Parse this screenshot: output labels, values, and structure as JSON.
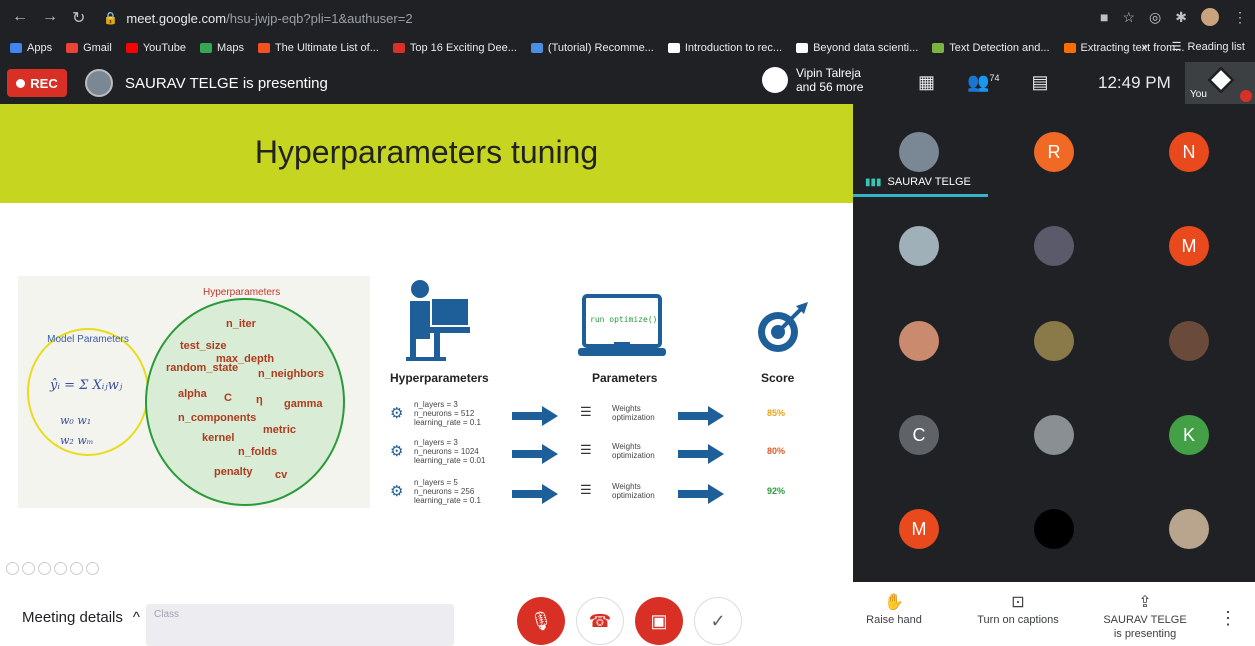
{
  "browser": {
    "url_host": "meet.google.com",
    "url_path": "/hsu-jwjp-eqb?pli=1&authuser=2",
    "bookmarks": [
      {
        "label": "Apps",
        "color": "#4285f4"
      },
      {
        "label": "Gmail",
        "color": "#ea4335"
      },
      {
        "label": "YouTube",
        "color": "#ff0000"
      },
      {
        "label": "Maps",
        "color": "#34a853"
      },
      {
        "label": "The Ultimate List of...",
        "color": "#f4511e"
      },
      {
        "label": "Top 16 Exciting Dee...",
        "color": "#d93025"
      },
      {
        "label": "(Tutorial) Recomme...",
        "color": "#4a90e2"
      },
      {
        "label": "Introduction to rec...",
        "color": "#ffffff"
      },
      {
        "label": "Beyond data scienti...",
        "color": "#ffffff"
      },
      {
        "label": "Text Detection and...",
        "color": "#7cb342"
      },
      {
        "label": "Extracting text from...",
        "color": "#ff6d00"
      }
    ],
    "reading_list": "Reading list",
    "overflow": "»"
  },
  "meet": {
    "rec_label": "REC",
    "presenting_text": "SAURAV TELGE is presenting",
    "vip_name": "Vipin Talreja",
    "vip_more": "and 56 more",
    "people_count": "74",
    "clock": "12:49 PM",
    "you_label": "You"
  },
  "slide": {
    "title": "Hyperparameters tuning",
    "model_params_title": "Model Parameters",
    "formula": "ŷᵢ = Σ Xᵢⱼwⱼ",
    "w_row1": "w₀   w₁",
    "w_row2": "w₂   wₘ",
    "hyper_title": "Hyperparameters",
    "hyperparams": [
      "n_iter",
      "test_size",
      "max_depth",
      "random_state",
      "n_neighbors",
      "alpha",
      "C",
      "η",
      "gamma",
      "n_components",
      "metric",
      "kernel",
      "n_folds",
      "penalty",
      "cv"
    ],
    "col_hyper": "Hyperparameters",
    "col_params": "Parameters",
    "col_score": "Score",
    "screen_text": "run optimize()",
    "rows": [
      {
        "hp": "n_layers = 3\nn_neurons = 512\nlearning_rate = 0.1",
        "param": "Weights\noptimization",
        "score": "85%",
        "score_color": "#e8a317"
      },
      {
        "hp": "n_layers = 3\nn_neurons = 1024\nlearning_rate = 0.01",
        "param": "Weights\noptimization",
        "score": "80%",
        "score_color": "#e05a2a"
      },
      {
        "hp": "n_layers = 5\nn_neurons = 256\nlearning_rate = 0.1",
        "param": "Weights\noptimization",
        "score": "92%",
        "score_color": "#2a9a3a"
      }
    ]
  },
  "participants": {
    "active_name": "SAURAV TELGE",
    "tiles": [
      {
        "letter": "",
        "color": "#7a8794"
      },
      {
        "letter": "R",
        "color": "#f06a25"
      },
      {
        "letter": "N",
        "color": "#e8491d"
      },
      {
        "letter": "",
        "color": "#9fb0b8"
      },
      {
        "letter": "",
        "color": "#5a5a6a"
      },
      {
        "letter": "M",
        "color": "#e8491d"
      },
      {
        "letter": "",
        "color": "#c98a6e"
      },
      {
        "letter": "",
        "color": "#8a7a4a"
      },
      {
        "letter": "",
        "color": "#6a4a3a"
      },
      {
        "letter": "C",
        "color": "#5f6368"
      },
      {
        "letter": "",
        "color": "#8a8f94"
      },
      {
        "letter": "K",
        "color": "#43a047"
      },
      {
        "letter": "M",
        "color": "#e8491d"
      },
      {
        "letter": "",
        "color": "#000000"
      },
      {
        "letter": "",
        "color": "#b9a58e"
      }
    ]
  },
  "bottom": {
    "meeting_details": "Meeting details",
    "ghost_label": "Class",
    "raise_hand": "Raise hand",
    "captions": "Turn on captions",
    "presenting_line1": "SAURAV TELGE",
    "presenting_line2": "is presenting"
  }
}
